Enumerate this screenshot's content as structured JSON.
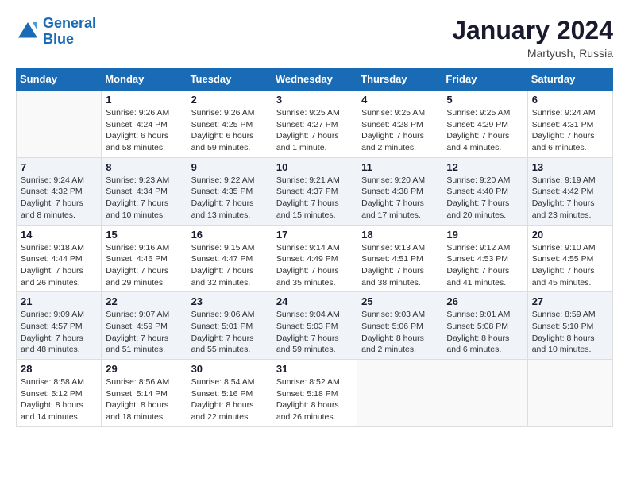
{
  "header": {
    "logo_line1": "General",
    "logo_line2": "Blue",
    "month_title": "January 2024",
    "location": "Martyush, Russia"
  },
  "weekdays": [
    "Sunday",
    "Monday",
    "Tuesday",
    "Wednesday",
    "Thursday",
    "Friday",
    "Saturday"
  ],
  "weeks": [
    [
      {
        "day": "",
        "info": ""
      },
      {
        "day": "1",
        "info": "Sunrise: 9:26 AM\nSunset: 4:24 PM\nDaylight: 6 hours\nand 58 minutes."
      },
      {
        "day": "2",
        "info": "Sunrise: 9:26 AM\nSunset: 4:25 PM\nDaylight: 6 hours\nand 59 minutes."
      },
      {
        "day": "3",
        "info": "Sunrise: 9:25 AM\nSunset: 4:27 PM\nDaylight: 7 hours\nand 1 minute."
      },
      {
        "day": "4",
        "info": "Sunrise: 9:25 AM\nSunset: 4:28 PM\nDaylight: 7 hours\nand 2 minutes."
      },
      {
        "day": "5",
        "info": "Sunrise: 9:25 AM\nSunset: 4:29 PM\nDaylight: 7 hours\nand 4 minutes."
      },
      {
        "day": "6",
        "info": "Sunrise: 9:24 AM\nSunset: 4:31 PM\nDaylight: 7 hours\nand 6 minutes."
      }
    ],
    [
      {
        "day": "7",
        "info": "Sunrise: 9:24 AM\nSunset: 4:32 PM\nDaylight: 7 hours\nand 8 minutes."
      },
      {
        "day": "8",
        "info": "Sunrise: 9:23 AM\nSunset: 4:34 PM\nDaylight: 7 hours\nand 10 minutes."
      },
      {
        "day": "9",
        "info": "Sunrise: 9:22 AM\nSunset: 4:35 PM\nDaylight: 7 hours\nand 13 minutes."
      },
      {
        "day": "10",
        "info": "Sunrise: 9:21 AM\nSunset: 4:37 PM\nDaylight: 7 hours\nand 15 minutes."
      },
      {
        "day": "11",
        "info": "Sunrise: 9:20 AM\nSunset: 4:38 PM\nDaylight: 7 hours\nand 17 minutes."
      },
      {
        "day": "12",
        "info": "Sunrise: 9:20 AM\nSunset: 4:40 PM\nDaylight: 7 hours\nand 20 minutes."
      },
      {
        "day": "13",
        "info": "Sunrise: 9:19 AM\nSunset: 4:42 PM\nDaylight: 7 hours\nand 23 minutes."
      }
    ],
    [
      {
        "day": "14",
        "info": "Sunrise: 9:18 AM\nSunset: 4:44 PM\nDaylight: 7 hours\nand 26 minutes."
      },
      {
        "day": "15",
        "info": "Sunrise: 9:16 AM\nSunset: 4:46 PM\nDaylight: 7 hours\nand 29 minutes."
      },
      {
        "day": "16",
        "info": "Sunrise: 9:15 AM\nSunset: 4:47 PM\nDaylight: 7 hours\nand 32 minutes."
      },
      {
        "day": "17",
        "info": "Sunrise: 9:14 AM\nSunset: 4:49 PM\nDaylight: 7 hours\nand 35 minutes."
      },
      {
        "day": "18",
        "info": "Sunrise: 9:13 AM\nSunset: 4:51 PM\nDaylight: 7 hours\nand 38 minutes."
      },
      {
        "day": "19",
        "info": "Sunrise: 9:12 AM\nSunset: 4:53 PM\nDaylight: 7 hours\nand 41 minutes."
      },
      {
        "day": "20",
        "info": "Sunrise: 9:10 AM\nSunset: 4:55 PM\nDaylight: 7 hours\nand 45 minutes."
      }
    ],
    [
      {
        "day": "21",
        "info": "Sunrise: 9:09 AM\nSunset: 4:57 PM\nDaylight: 7 hours\nand 48 minutes."
      },
      {
        "day": "22",
        "info": "Sunrise: 9:07 AM\nSunset: 4:59 PM\nDaylight: 7 hours\nand 51 minutes."
      },
      {
        "day": "23",
        "info": "Sunrise: 9:06 AM\nSunset: 5:01 PM\nDaylight: 7 hours\nand 55 minutes."
      },
      {
        "day": "24",
        "info": "Sunrise: 9:04 AM\nSunset: 5:03 PM\nDaylight: 7 hours\nand 59 minutes."
      },
      {
        "day": "25",
        "info": "Sunrise: 9:03 AM\nSunset: 5:06 PM\nDaylight: 8 hours\nand 2 minutes."
      },
      {
        "day": "26",
        "info": "Sunrise: 9:01 AM\nSunset: 5:08 PM\nDaylight: 8 hours\nand 6 minutes."
      },
      {
        "day": "27",
        "info": "Sunrise: 8:59 AM\nSunset: 5:10 PM\nDaylight: 8 hours\nand 10 minutes."
      }
    ],
    [
      {
        "day": "28",
        "info": "Sunrise: 8:58 AM\nSunset: 5:12 PM\nDaylight: 8 hours\nand 14 minutes."
      },
      {
        "day": "29",
        "info": "Sunrise: 8:56 AM\nSunset: 5:14 PM\nDaylight: 8 hours\nand 18 minutes."
      },
      {
        "day": "30",
        "info": "Sunrise: 8:54 AM\nSunset: 5:16 PM\nDaylight: 8 hours\nand 22 minutes."
      },
      {
        "day": "31",
        "info": "Sunrise: 8:52 AM\nSunset: 5:18 PM\nDaylight: 8 hours\nand 26 minutes."
      },
      {
        "day": "",
        "info": ""
      },
      {
        "day": "",
        "info": ""
      },
      {
        "day": "",
        "info": ""
      }
    ]
  ]
}
